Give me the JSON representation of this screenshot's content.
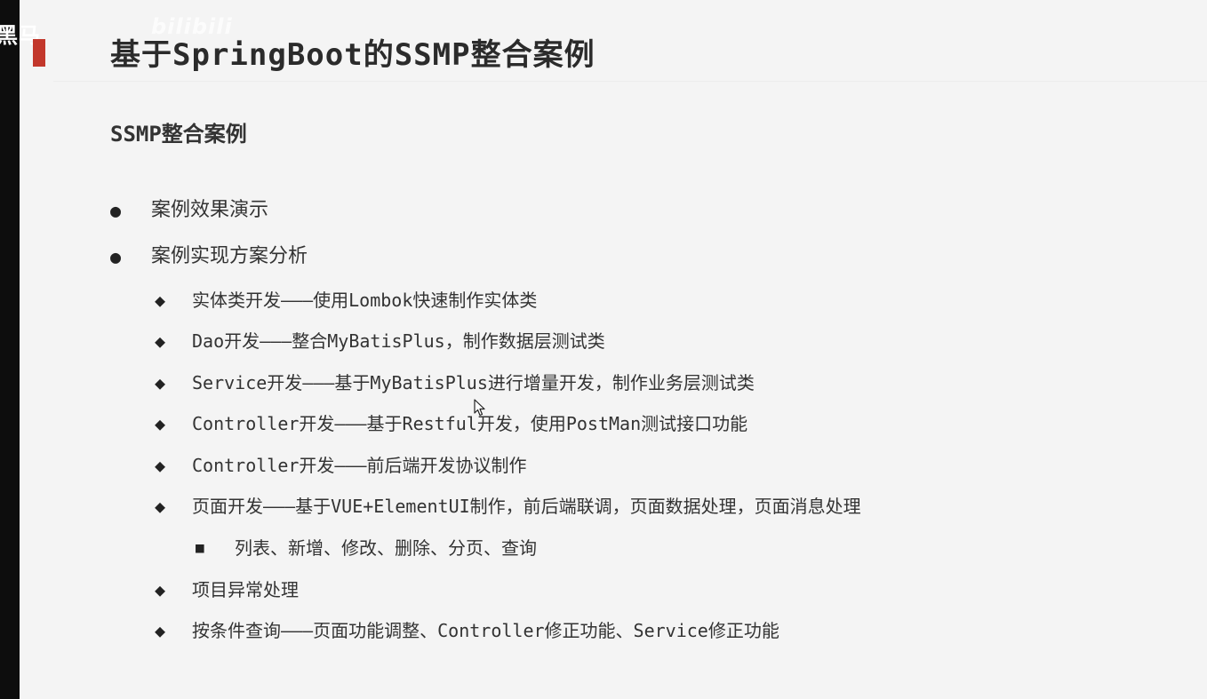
{
  "watermark": {
    "left_text": "黑马",
    "right_text": "bilibili"
  },
  "slide": {
    "title": "基于SpringBoot的SSMP整合案例",
    "section_heading": "SSMP整合案例",
    "bullets_level1": [
      "案例效果演示",
      "案例实现方案分析"
    ],
    "bullets_level2": [
      "实体类开发———使用Lombok快速制作实体类",
      "Dao开发———整合MyBatisPlus，制作数据层测试类",
      "Service开发———基于MyBatisPlus进行增量开发，制作业务层测试类",
      "Controller开发———基于Restful开发，使用PostMan测试接口功能",
      "Controller开发———前后端开发协议制作",
      "页面开发———基于VUE+ElementUI制作，前后端联调，页面数据处理，页面消息处理",
      "项目异常处理",
      "按条件查询———页面功能调整、Controller修正功能、Service修正功能"
    ],
    "bullets_level3": [
      "列表、新增、修改、删除、分页、查询"
    ],
    "markers": {
      "level1": "●",
      "level2": "◆",
      "level3": "■"
    }
  },
  "colors": {
    "accent": "#c2372b",
    "background": "#f4f4f4",
    "text": "#333333",
    "left_strip": "#0d0d0d"
  },
  "icons": {
    "cursor": "mouse-pointer-icon"
  }
}
